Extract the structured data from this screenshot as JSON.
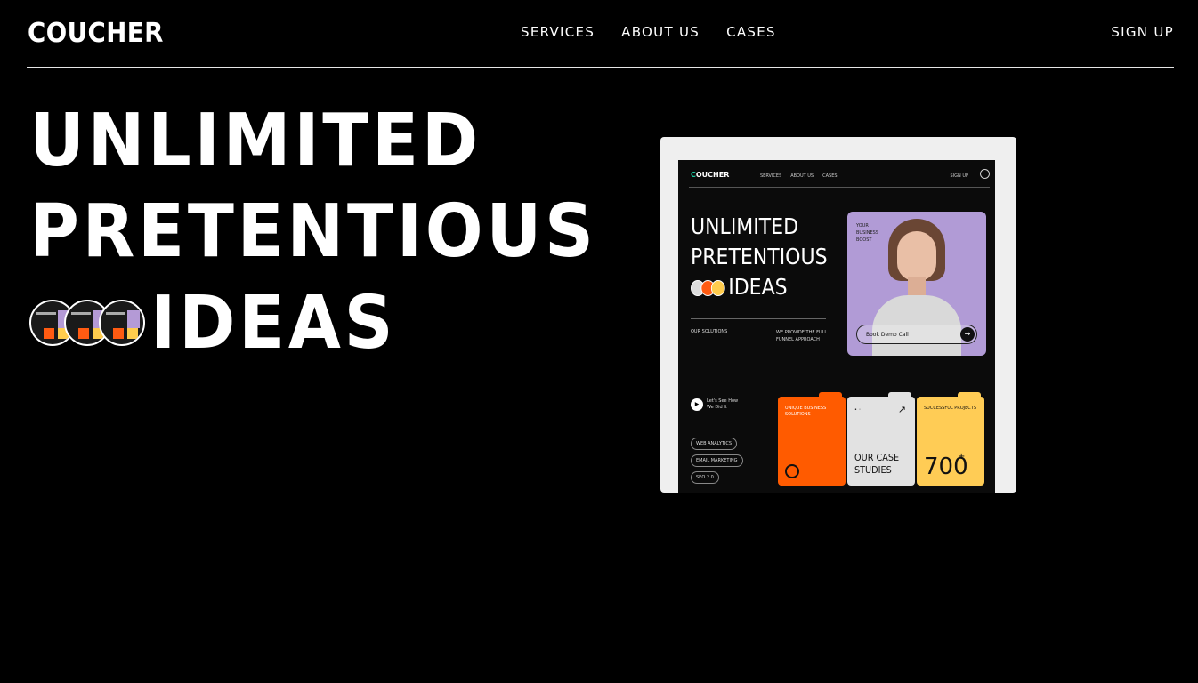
{
  "brand": {
    "name": "COUCHER"
  },
  "nav": {
    "items": [
      "SERVICES",
      "ABOUT US",
      "CASES"
    ],
    "signup": "SIGN UP"
  },
  "hero": {
    "line1": "UNLIMITED",
    "line2": "PRETENTIOUS",
    "line3": "IDEAS"
  },
  "preview": {
    "logo_c": "C",
    "logo_rest": "OUCHER",
    "nav": [
      "SERVICES",
      "ABOUT US",
      "CASES"
    ],
    "signup": "SIGN UP",
    "h1_line1": "UNLIMITED",
    "h1_line2": "PRETENTIOUS",
    "h1_line3": "IDEAS",
    "our_solutions": "OUR SOLUTIONS",
    "funnel": "WE PROVIDE THE FULL FUNNEL APPROACH",
    "boost": "YOUR BUSINESS BOOST",
    "book_demo": "Book Demo Call",
    "lets_see": "Let's See How We Did It",
    "tags": [
      "WEB ANALYTICS",
      "EMAIL MARKETING",
      "SEO 2.0"
    ],
    "card_orange": "UNIQUE BUSINESS SOLUTIONS",
    "card_gray": "OUR CASE STUDIES",
    "card_yellow_label": "SUCCESSFUL PROJECTS",
    "card_yellow_value": "700",
    "card_yellow_plus": "+"
  },
  "colors": {
    "background": "#000000",
    "text": "#ffffff",
    "preview_frame": "#efefef",
    "accent_orange": "#ff5b00",
    "accent_yellow": "#ffcc55",
    "accent_purple": "#b19bd6",
    "accent_green": "#1ad1a5"
  }
}
